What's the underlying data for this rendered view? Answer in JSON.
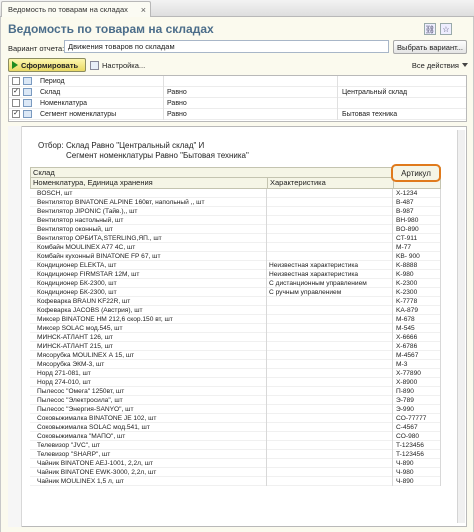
{
  "tab": {
    "title": "Ведомость по товарам на складах",
    "close": "×"
  },
  "header": {
    "title": "Ведомость по товарам на складах"
  },
  "variant": {
    "label": "Вариант отчета:",
    "value": "Движения товаров по складам",
    "select_button": "Выбрать вариант..."
  },
  "toolbar": {
    "run_button": "Сформировать",
    "settings_button": "Настройка...",
    "actions_button": "Все действия"
  },
  "filters": [
    {
      "checked": false,
      "name": "Период",
      "condition": "",
      "value": ""
    },
    {
      "checked": true,
      "name": "Склад",
      "condition": "Равно",
      "value": "Центральный склад"
    },
    {
      "checked": false,
      "name": "Номенклатура",
      "condition": "Равно",
      "value": ""
    },
    {
      "checked": true,
      "name": "Сегмент номенклатуры",
      "condition": "Равно",
      "value": "Бытовая техника"
    }
  ],
  "report": {
    "otbor_label": "Отбор:",
    "otbor_line1": "Склад Равно \"Центральный склад\" И",
    "otbor_line2": "Сегмент номенклатуры Равно \"Бытовая техника\"",
    "group_header": "Склад",
    "col_nomenclature": "Номенклатура, Единица хранения",
    "col_characteristic": "Характеристика",
    "col_article": "Артикул",
    "rows": [
      [
        "BOSCH, шт",
        "",
        "X-1234"
      ],
      [
        "Вентилятор BINATONE ALPINE 160вт, напольный ,, шт",
        "",
        "B-487"
      ],
      [
        "Вентилятор JIPONIC (Тайв.),, шт",
        "",
        "B-987"
      ],
      [
        "Вентилятор настольный, шт",
        "",
        "BH-980"
      ],
      [
        "Вентилятор оконный, шт",
        "",
        "BO-890"
      ],
      [
        "Вентилятор ОРБИТА,STERLING,ЯП., шт",
        "",
        "CT-911"
      ],
      [
        "Комбайн MOULINEX A77 4С, шт",
        "",
        "M-77"
      ],
      [
        "Комбайн кухонный BINATONE FP 67, шт",
        "",
        "KB- 900"
      ],
      [
        "Кондиционер ELEKTA, шт",
        "Неизвестная характеристика",
        "K-8888"
      ],
      [
        "Кондиционер FIRMSTAR 12М, шт",
        "Неизвестная характеристика",
        "K-980"
      ],
      [
        "Кондиционер БК-2300, шт",
        "С дистанционным управлением",
        "K-2300"
      ],
      [
        "Кондиционер БК-2300, шт",
        "С ручным управлением",
        "K-2300"
      ],
      [
        "Кофеварка BRAUN KF22R, шт",
        "",
        "K-7778"
      ],
      [
        "Кофеварка JACOBS (Австрия), шт",
        "",
        "KA-879"
      ],
      [
        "Миксер BINATONE HM 212,6 скор.150 вт, шт",
        "",
        "M-678"
      ],
      [
        "Миксер SOLAC мод.545, шт",
        "",
        "M-545"
      ],
      [
        "МИНСК-АТЛАНТ 126, шт",
        "",
        "X-6666"
      ],
      [
        "МИНСК-АТЛАНТ 215, шт",
        "",
        "X-6786"
      ],
      [
        "Мясорубка MOULINEX А 15, шт",
        "",
        "M-4567"
      ],
      [
        "Мясорубка ЭКМ-3, шт",
        "",
        "M-3"
      ],
      [
        "Норд 271-081, шт",
        "",
        "X-77890"
      ],
      [
        "Норд 274-010, шт",
        "",
        "X-8900"
      ],
      [
        "Пылесос \"Омега\" 1250вт, шт",
        "",
        "П-890"
      ],
      [
        "Пылесос \"Электросила\", шт",
        "",
        "Э-789"
      ],
      [
        "Пылесос \"Энергия-SANYO\", шт",
        "",
        "Э-990"
      ],
      [
        "Соковыжималка BINATONE JE 102, шт",
        "",
        "CO-77777"
      ],
      [
        "Соковыжималка  SOLAC мод.541, шт",
        "",
        "C-4567"
      ],
      [
        "Соковыжималка \"МАПО\", шт",
        "",
        "CO-980"
      ],
      [
        "Телевизор \"JVC\", шт",
        "",
        "T-123456"
      ],
      [
        "Телевизор \"SHARP\", шт",
        "",
        "T-123456"
      ],
      [
        "Чайник BINATONE  AEJ-1001,  2,2л, шт",
        "",
        "Ч-890"
      ],
      [
        "Чайник BINATONE  EWK-3000,  2,2л, шт",
        "",
        "Ч-980"
      ],
      [
        "Чайник MOULINEX 1,5 л, шт",
        "",
        "Ч-890"
      ]
    ]
  }
}
